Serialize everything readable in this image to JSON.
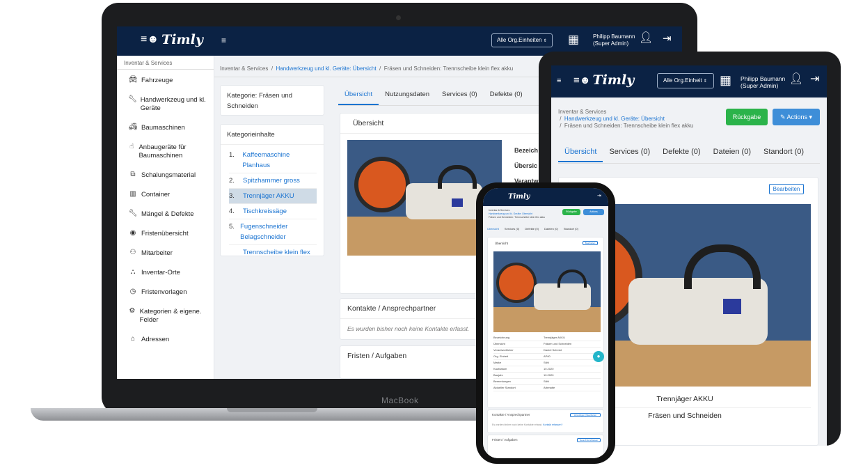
{
  "brand": {
    "logo_text": "Timly",
    "laptop_label": "MacBook"
  },
  "navbar": {
    "org_select": "Alle Org.Einheiten",
    "org_select_short": "Alle Org.Einheit",
    "user_name": "Philipp Baumann",
    "user_role": "(Super Admin)"
  },
  "sidebar": {
    "header": "Inventar & Services",
    "items": [
      {
        "label": "Fahrzeuge",
        "icon": "car-icon"
      },
      {
        "label": "Handwerkzeug und kl. Geräte",
        "icon": "wrench-icon"
      },
      {
        "label": "Baumaschinen",
        "icon": "truck-icon"
      },
      {
        "label": "Anbaugeräte für Baumaschinen",
        "icon": "hand-icon"
      },
      {
        "label": "Schalungsmaterial",
        "icon": "cubes-icon"
      },
      {
        "label": "Container",
        "icon": "building-icon"
      },
      {
        "label": "Mängel & Defekte",
        "icon": "wrench-icon"
      },
      {
        "label": "Fristenübersicht",
        "icon": "eye-icon"
      },
      {
        "label": "Mitarbeiter",
        "icon": "users-icon"
      },
      {
        "label": "Inventar-Orte",
        "icon": "sitemap-icon"
      },
      {
        "label": "Fristenvorlagen",
        "icon": "clock-icon"
      },
      {
        "label": "Kategorien & eigene. Felder",
        "icon": "gear-icon"
      },
      {
        "label": "Adressen",
        "icon": "home-icon"
      }
    ]
  },
  "breadcrumb": {
    "root": "Inventar & Services",
    "category": "Handwerkzeug und kl. Geräte: Übersicht",
    "current": "Fräsen und Schneiden: Trennscheibe klein flex akku"
  },
  "category_panel": {
    "title": "Kategorie: Fräsen und Schneiden",
    "contents_title": "Kategorieinhalte",
    "items": [
      {
        "num": "1.",
        "label": "Kaffeemaschine Planhaus"
      },
      {
        "num": "2.",
        "label": "Spitzhammer gross"
      },
      {
        "num": "3.",
        "label": "Trennjäger AKKU"
      },
      {
        "num": "4.",
        "label": "Tischkreissäge"
      },
      {
        "num": "5.",
        "label": "Fugenschneider Belagschneider"
      },
      {
        "num": "",
        "label": "Trennscheibe klein flex"
      }
    ]
  },
  "tabs_laptop": [
    "Übersicht",
    "Nutzungsdaten",
    "Services (0)",
    "Defekte (0)"
  ],
  "tabs_tablet": [
    "Übersicht",
    "Services (0)",
    "Defekte (0)",
    "Dateien (0)",
    "Standort (0)"
  ],
  "detail": {
    "overview_title": "Übersicht",
    "fields_partial": [
      "Bezeich",
      "Übersic",
      "Verantw"
    ],
    "contacts_title": "Kontakte / Ansprechpartner",
    "contacts_empty": "Es wurden bisher noch keine Kontakte erfasst.",
    "deadlines_title": "Fristen / Aufgaben"
  },
  "tablet": {
    "return_button": "Rückgabe",
    "actions_button": "Actions",
    "edit_button": "Bearbeiten",
    "item_name": "Trennjäger AKKU",
    "item_category": "Fräsen und Schneiden"
  },
  "phone": {
    "fields": [
      {
        "k": "Bezeichnung",
        "v": "Trennjäger AKKU"
      },
      {
        "k": "Übersicht",
        "v": "Fräsen und Schneiden"
      },
      {
        "k": "Verantwortlicher",
        "v": "Daniel Schmid"
      },
      {
        "k": "Org. Einheit",
        "v": "AP00"
      },
      {
        "k": "Marke",
        "v": "Stihl"
      },
      {
        "k": "Kaufdatum",
        "v": "10.2020"
      },
      {
        "k": "Baujahr",
        "v": "10.2020"
      },
      {
        "k": "Bemerkungen",
        "v": "Stihl"
      },
      {
        "k": "Aktueller Standort",
        "v": "Arbmatte"
      }
    ],
    "contacts_add": "Hinzufügen | Bearbeiten",
    "contacts_empty": "Es wurden bisher noch keine Kontakte erfasst.",
    "contacts_link": "Kontakt erfassen?",
    "deadline_add": "Neue Frist erfassen"
  }
}
